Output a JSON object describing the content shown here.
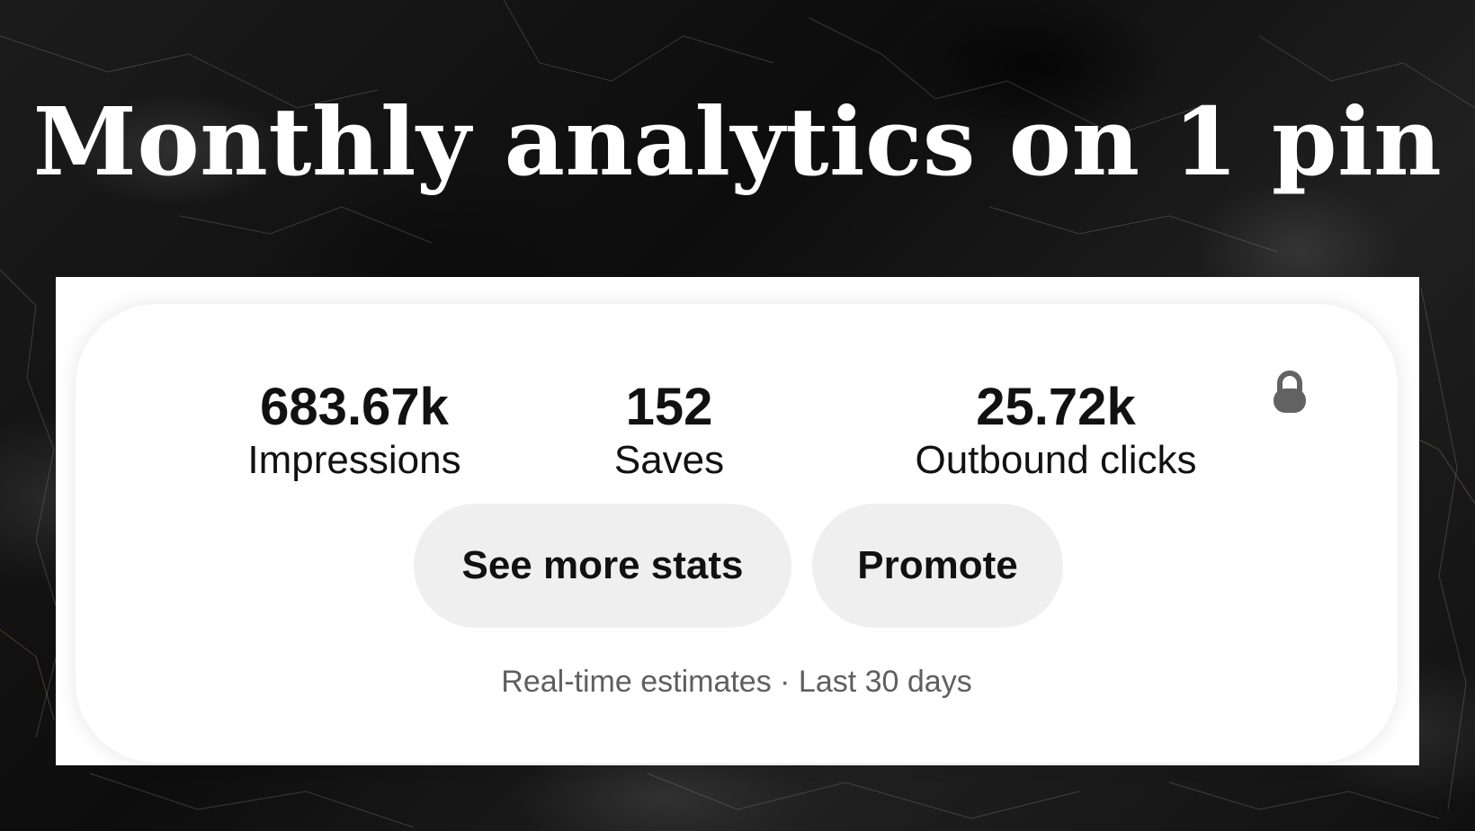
{
  "title": "Monthly analytics on 1 pin",
  "stats": [
    {
      "value": "683.67k",
      "label": "Impressions"
    },
    {
      "value": "152",
      "label": "Saves"
    },
    {
      "value": "25.72k",
      "label": "Outbound clicks"
    }
  ],
  "lock_icon": "lock-icon",
  "buttons": {
    "see_more": "See more stats",
    "promote": "Promote"
  },
  "footnote": "Real-time estimates · Last 30 days",
  "colors": {
    "background": "#141414",
    "card": "#ffffff",
    "button": "#efefef",
    "text": "#111111",
    "muted_text": "#5f5f5f"
  }
}
